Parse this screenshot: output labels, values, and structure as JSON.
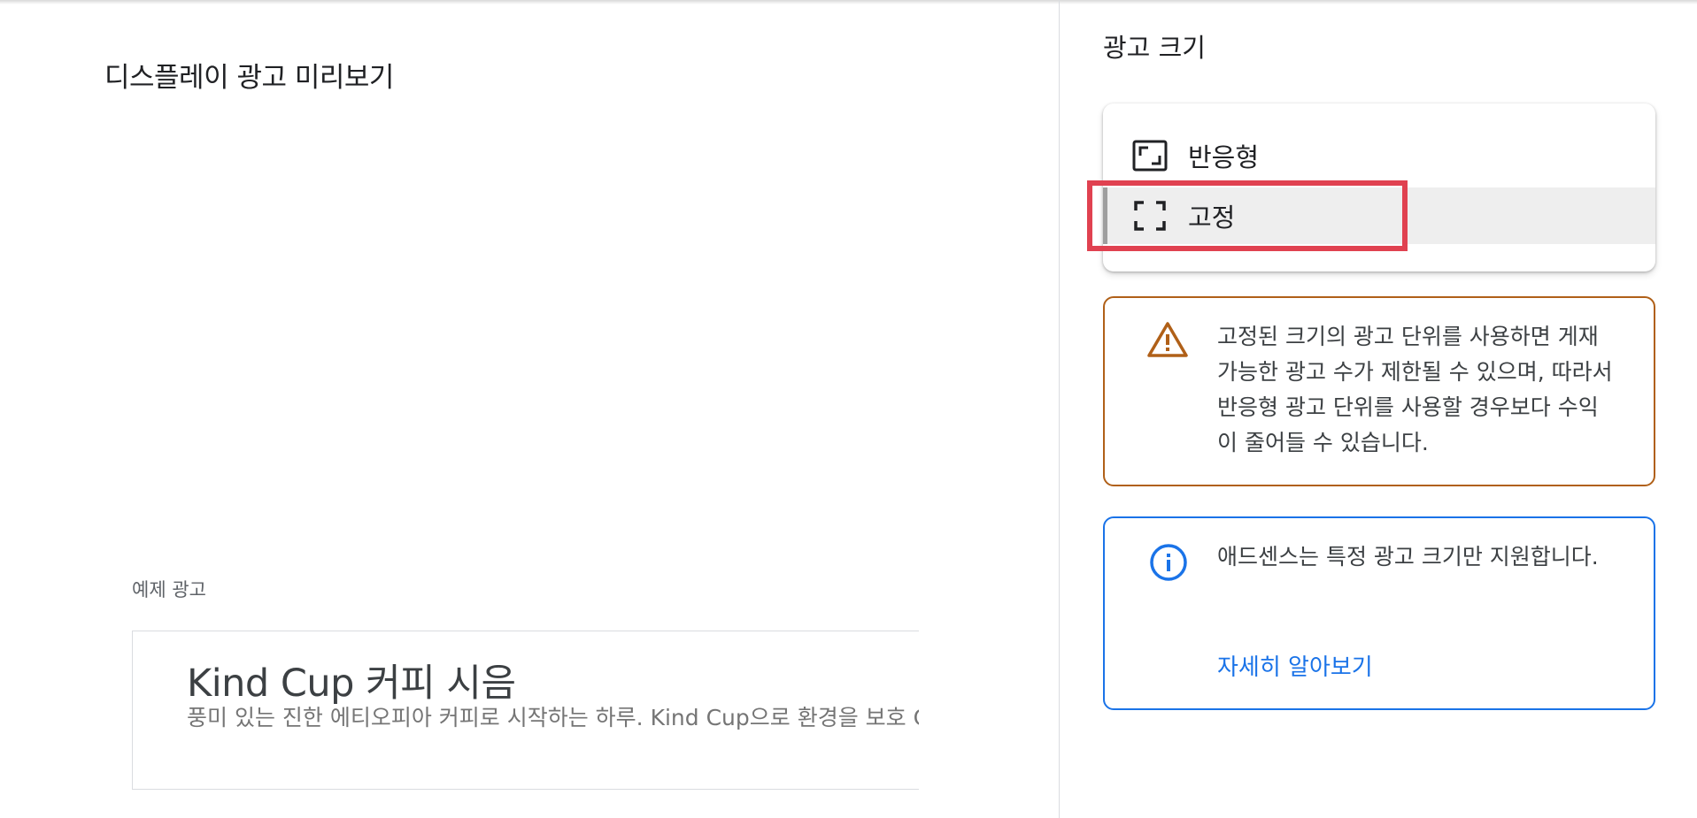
{
  "preview": {
    "title": "디스플레이 광고 미리보기",
    "sample_label": "예제 광고",
    "ad": {
      "headline": "Kind Cup 커피 시음",
      "description": "풍미 있는 진한 에티오피아 커피로 시작하는 하루. Kind Cup으로 환경을 보호 Cup 커피 회사"
    }
  },
  "ad_size": {
    "heading": "광고 크기",
    "options": [
      {
        "label": "반응형",
        "icon": "responsive-icon"
      },
      {
        "label": "고정",
        "icon": "fixed-size-icon"
      }
    ],
    "selected": "고정"
  },
  "warning": {
    "icon": "warning-icon",
    "text": "고정된 크기의 광고 단위를 사용하면 게재 가능한 광고 수가 제한될 수 있으며, 따라서 반응형 광고 단위를 사용할 경우보다 수익이 줄어들 수 있습니다.",
    "color": "#b06018"
  },
  "info": {
    "icon": "info-icon",
    "text": "애드센스는 특정 광고 크기만 지원합니다.",
    "link_label": "자세히 알아보기",
    "color": "#1a73e8"
  },
  "colors": {
    "highlight": "#e04150",
    "link": "#1a73e8"
  }
}
